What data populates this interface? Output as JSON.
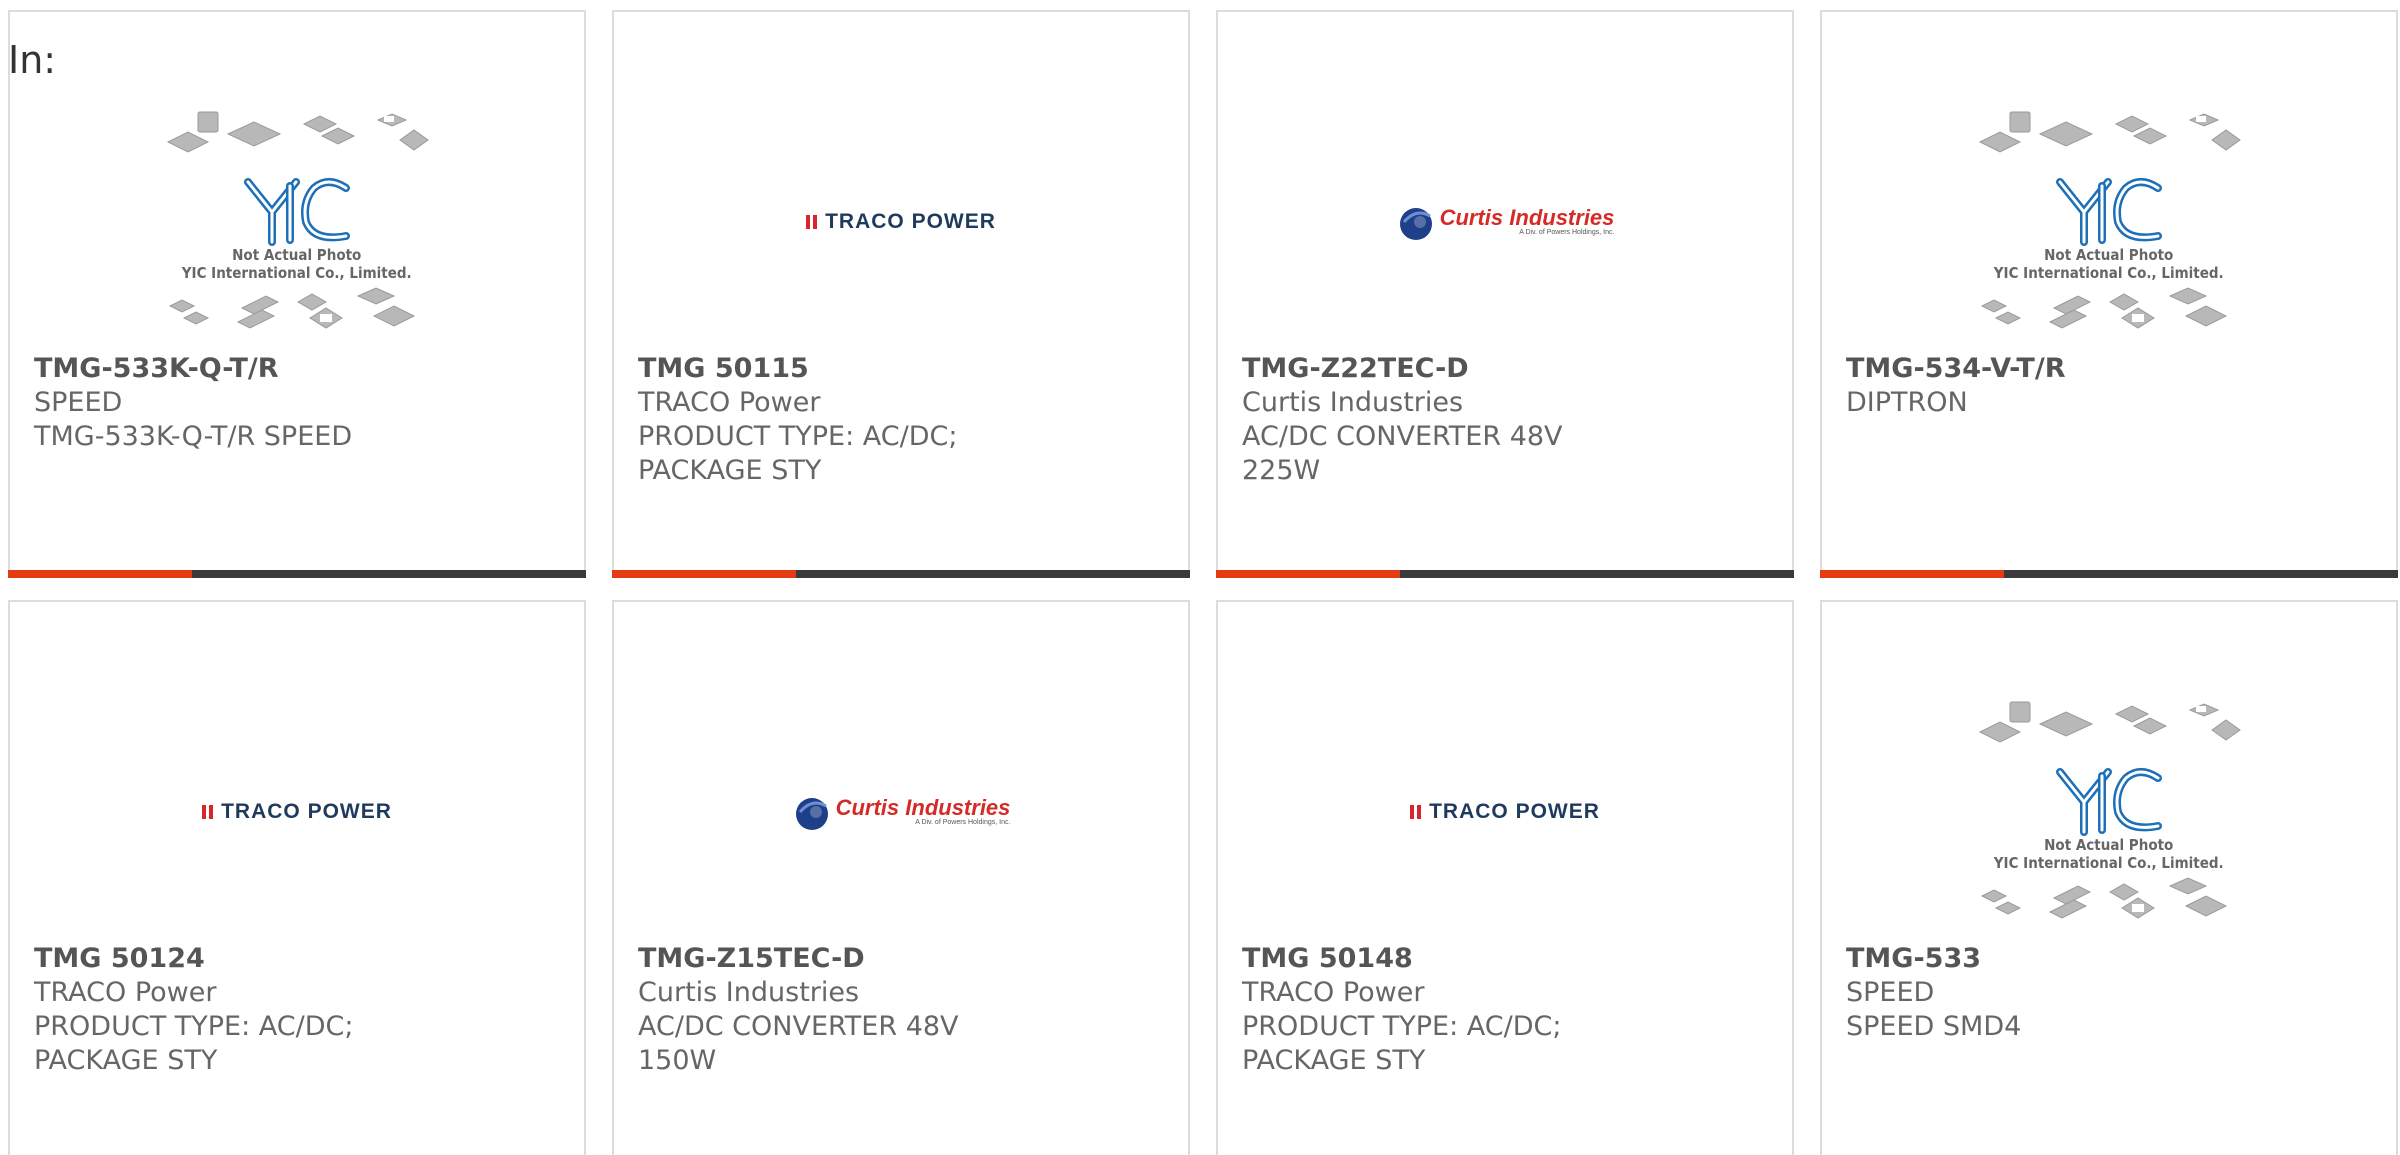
{
  "filter_label": "In:",
  "products": [
    {
      "part_number": "TMG-533K-Q-T/R",
      "manufacturer": "SPEED",
      "description": "TMG-533K-Q-T/R SPEED",
      "image": "yic-placeholder",
      "image_text": {
        "line1": "Not Actual Photo",
        "line2": "YIC International Co., Limited."
      }
    },
    {
      "part_number": "TMG 50115",
      "manufacturer": "TRACO Power",
      "description": "PRODUCT TYPE: AC/DC; PACKAGE STY",
      "image": "traco-logo",
      "image_text": {
        "name": "TRACO POWER"
      }
    },
    {
      "part_number": "TMG-Z22TEC-D",
      "manufacturer": "Curtis Industries",
      "description": "AC/DC CONVERTER 48V 225W",
      "image": "curtis-logo",
      "image_text": {
        "name": "Curtis Industries",
        "tagline": "A Div. of Powers Holdings, Inc."
      }
    },
    {
      "part_number": "TMG-534-V-T/R",
      "manufacturer": "DIPTRON",
      "description": "",
      "image": "yic-placeholder",
      "image_text": {
        "line1": "Not Actual Photo",
        "line2": "YIC International Co., Limited."
      }
    },
    {
      "part_number": "TMG 50124",
      "manufacturer": "TRACO Power",
      "description": "PRODUCT TYPE: AC/DC; PACKAGE STY",
      "image": "traco-logo",
      "image_text": {
        "name": "TRACO POWER"
      }
    },
    {
      "part_number": "TMG-Z15TEC-D",
      "manufacturer": "Curtis Industries",
      "description": "AC/DC CONVERTER 48V 150W",
      "image": "curtis-logo",
      "image_text": {
        "name": "Curtis Industries",
        "tagline": "A Div. of Powers Holdings, Inc."
      }
    },
    {
      "part_number": "TMG 50148",
      "manufacturer": "TRACO Power",
      "description": "PRODUCT TYPE: AC/DC; PACKAGE STY",
      "image": "traco-logo",
      "image_text": {
        "name": "TRACO POWER"
      }
    },
    {
      "part_number": "TMG-533",
      "manufacturer": "SPEED",
      "description": "SPEED SMD4",
      "image": "yic-placeholder",
      "image_text": {
        "line1": "Not Actual Photo",
        "line2": "YIC International Co., Limited."
      }
    }
  ],
  "colors": {
    "accent": "#e43b13",
    "bar": "#3a3a3a",
    "border": "#dcdcdc",
    "text": "#666666",
    "traco_red": "#d7262e",
    "traco_blue": "#1f3a5c",
    "curtis_red": "#d52a26",
    "curtis_blue": "#1e3f8a",
    "yic_blue": "#1d6fb8"
  }
}
